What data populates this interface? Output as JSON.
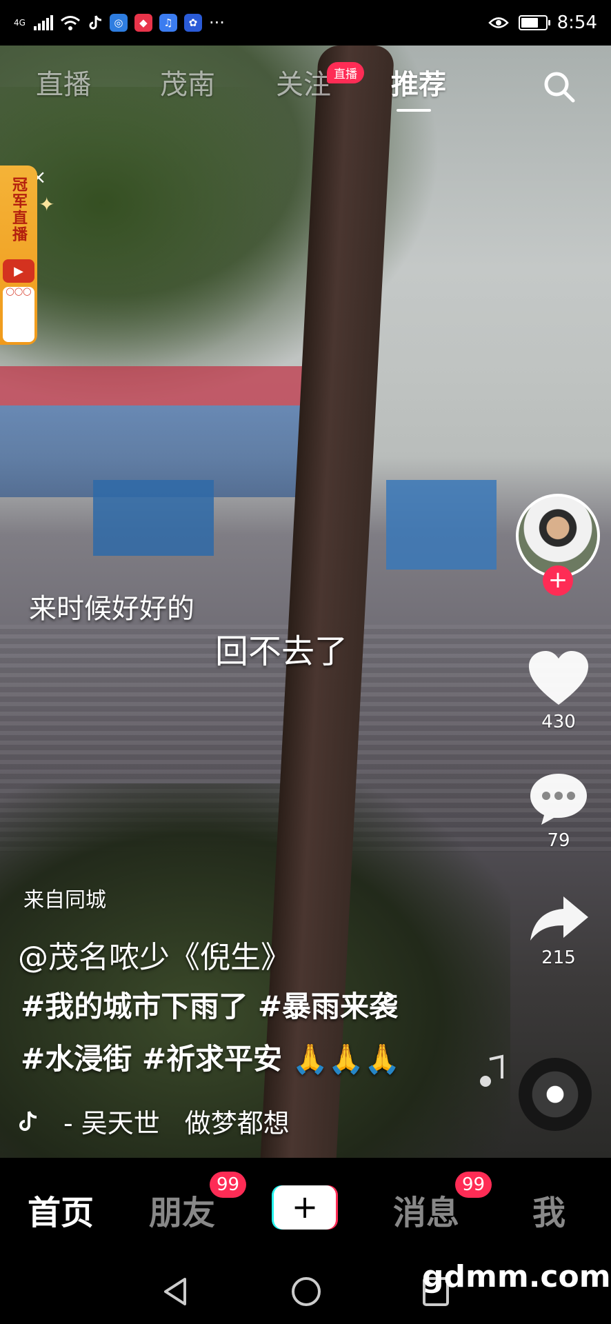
{
  "status_bar": {
    "network": "4G",
    "time": "8:54",
    "battery_percent": 70
  },
  "top_tabs": {
    "live": "直播",
    "local": "茂南",
    "following": "关注",
    "following_badge": "直播",
    "recommended": "推荐"
  },
  "promo": {
    "text": "冠军直播",
    "play_icon": "play-icon",
    "close": "×"
  },
  "video": {
    "caption_1": "来时候好好的",
    "caption_2": "回不去了"
  },
  "actions": {
    "likes": "430",
    "comments": "79",
    "shares": "215"
  },
  "post": {
    "source": "来自同城",
    "author": "@茂名哝少《倪生》",
    "description_line1": "#我的城市下雨了 #暴雨来袭",
    "description_line2": "#水浸街 #祈求平安 🙏🙏🙏",
    "music_artist": "- 吴天世",
    "music_title": "做梦都想"
  },
  "bottom_nav": {
    "home": "首页",
    "friends": "朋友",
    "friends_badge": "99",
    "create": "+",
    "messages": "消息",
    "messages_badge": "99",
    "me": "我"
  },
  "watermark": "gdmm.com",
  "colors": {
    "accent": "#fe2c55",
    "cyan": "#25f4ee",
    "promo": "#f4b338"
  }
}
